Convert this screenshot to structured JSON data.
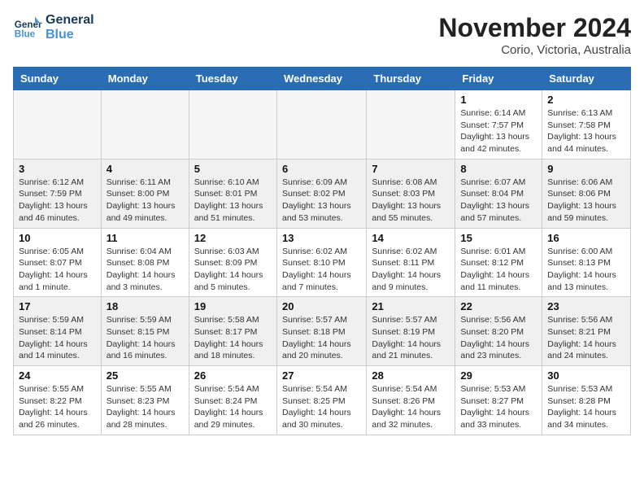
{
  "logo": {
    "line1": "General",
    "line2": "Blue"
  },
  "title": "November 2024",
  "location": "Corio, Victoria, Australia",
  "days_of_week": [
    "Sunday",
    "Monday",
    "Tuesday",
    "Wednesday",
    "Thursday",
    "Friday",
    "Saturday"
  ],
  "weeks": [
    [
      {
        "num": "",
        "info": "",
        "empty": true
      },
      {
        "num": "",
        "info": "",
        "empty": true
      },
      {
        "num": "",
        "info": "",
        "empty": true
      },
      {
        "num": "",
        "info": "",
        "empty": true
      },
      {
        "num": "",
        "info": "",
        "empty": true
      },
      {
        "num": "1",
        "info": "Sunrise: 6:14 AM\nSunset: 7:57 PM\nDaylight: 13 hours\nand 42 minutes."
      },
      {
        "num": "2",
        "info": "Sunrise: 6:13 AM\nSunset: 7:58 PM\nDaylight: 13 hours\nand 44 minutes."
      }
    ],
    [
      {
        "num": "3",
        "info": "Sunrise: 6:12 AM\nSunset: 7:59 PM\nDaylight: 13 hours\nand 46 minutes."
      },
      {
        "num": "4",
        "info": "Sunrise: 6:11 AM\nSunset: 8:00 PM\nDaylight: 13 hours\nand 49 minutes."
      },
      {
        "num": "5",
        "info": "Sunrise: 6:10 AM\nSunset: 8:01 PM\nDaylight: 13 hours\nand 51 minutes."
      },
      {
        "num": "6",
        "info": "Sunrise: 6:09 AM\nSunset: 8:02 PM\nDaylight: 13 hours\nand 53 minutes."
      },
      {
        "num": "7",
        "info": "Sunrise: 6:08 AM\nSunset: 8:03 PM\nDaylight: 13 hours\nand 55 minutes."
      },
      {
        "num": "8",
        "info": "Sunrise: 6:07 AM\nSunset: 8:04 PM\nDaylight: 13 hours\nand 57 minutes."
      },
      {
        "num": "9",
        "info": "Sunrise: 6:06 AM\nSunset: 8:06 PM\nDaylight: 13 hours\nand 59 minutes."
      }
    ],
    [
      {
        "num": "10",
        "info": "Sunrise: 6:05 AM\nSunset: 8:07 PM\nDaylight: 14 hours\nand 1 minute."
      },
      {
        "num": "11",
        "info": "Sunrise: 6:04 AM\nSunset: 8:08 PM\nDaylight: 14 hours\nand 3 minutes."
      },
      {
        "num": "12",
        "info": "Sunrise: 6:03 AM\nSunset: 8:09 PM\nDaylight: 14 hours\nand 5 minutes."
      },
      {
        "num": "13",
        "info": "Sunrise: 6:02 AM\nSunset: 8:10 PM\nDaylight: 14 hours\nand 7 minutes."
      },
      {
        "num": "14",
        "info": "Sunrise: 6:02 AM\nSunset: 8:11 PM\nDaylight: 14 hours\nand 9 minutes."
      },
      {
        "num": "15",
        "info": "Sunrise: 6:01 AM\nSunset: 8:12 PM\nDaylight: 14 hours\nand 11 minutes."
      },
      {
        "num": "16",
        "info": "Sunrise: 6:00 AM\nSunset: 8:13 PM\nDaylight: 14 hours\nand 13 minutes."
      }
    ],
    [
      {
        "num": "17",
        "info": "Sunrise: 5:59 AM\nSunset: 8:14 PM\nDaylight: 14 hours\nand 14 minutes."
      },
      {
        "num": "18",
        "info": "Sunrise: 5:59 AM\nSunset: 8:15 PM\nDaylight: 14 hours\nand 16 minutes."
      },
      {
        "num": "19",
        "info": "Sunrise: 5:58 AM\nSunset: 8:17 PM\nDaylight: 14 hours\nand 18 minutes."
      },
      {
        "num": "20",
        "info": "Sunrise: 5:57 AM\nSunset: 8:18 PM\nDaylight: 14 hours\nand 20 minutes."
      },
      {
        "num": "21",
        "info": "Sunrise: 5:57 AM\nSunset: 8:19 PM\nDaylight: 14 hours\nand 21 minutes."
      },
      {
        "num": "22",
        "info": "Sunrise: 5:56 AM\nSunset: 8:20 PM\nDaylight: 14 hours\nand 23 minutes."
      },
      {
        "num": "23",
        "info": "Sunrise: 5:56 AM\nSunset: 8:21 PM\nDaylight: 14 hours\nand 24 minutes."
      }
    ],
    [
      {
        "num": "24",
        "info": "Sunrise: 5:55 AM\nSunset: 8:22 PM\nDaylight: 14 hours\nand 26 minutes."
      },
      {
        "num": "25",
        "info": "Sunrise: 5:55 AM\nSunset: 8:23 PM\nDaylight: 14 hours\nand 28 minutes."
      },
      {
        "num": "26",
        "info": "Sunrise: 5:54 AM\nSunset: 8:24 PM\nDaylight: 14 hours\nand 29 minutes."
      },
      {
        "num": "27",
        "info": "Sunrise: 5:54 AM\nSunset: 8:25 PM\nDaylight: 14 hours\nand 30 minutes."
      },
      {
        "num": "28",
        "info": "Sunrise: 5:54 AM\nSunset: 8:26 PM\nDaylight: 14 hours\nand 32 minutes."
      },
      {
        "num": "29",
        "info": "Sunrise: 5:53 AM\nSunset: 8:27 PM\nDaylight: 14 hours\nand 33 minutes."
      },
      {
        "num": "30",
        "info": "Sunrise: 5:53 AM\nSunset: 8:28 PM\nDaylight: 14 hours\nand 34 minutes."
      }
    ]
  ]
}
